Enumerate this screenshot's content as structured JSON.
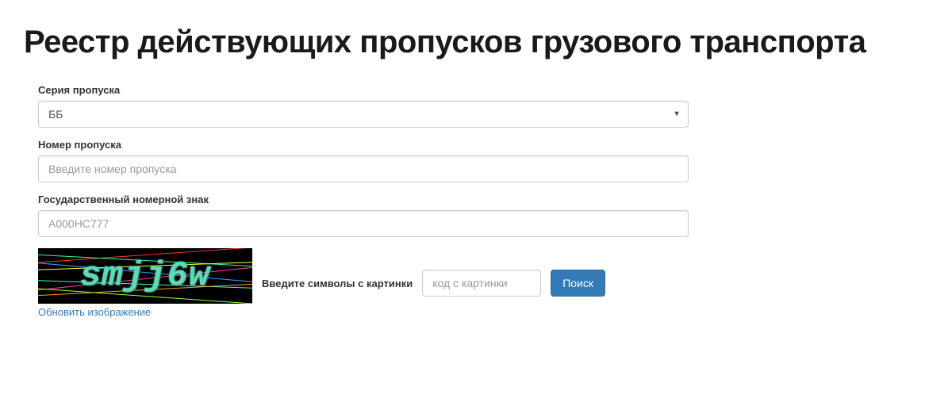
{
  "page": {
    "title": "Реестр действующих пропусков грузового транспорта"
  },
  "form": {
    "series": {
      "label": "Серия пропуска",
      "value": "ББ"
    },
    "number": {
      "label": "Номер пропуска",
      "placeholder": "Введите номер пропуска"
    },
    "plate": {
      "label": "Государственный номерной знак",
      "placeholder": "А000НС777"
    },
    "captcha": {
      "image_text": "smjj6w",
      "refresh_label": "Обновить изображение",
      "input_label": "Введите символы с картинки",
      "input_placeholder": "код с картинки"
    },
    "search_button": "Поиск"
  }
}
